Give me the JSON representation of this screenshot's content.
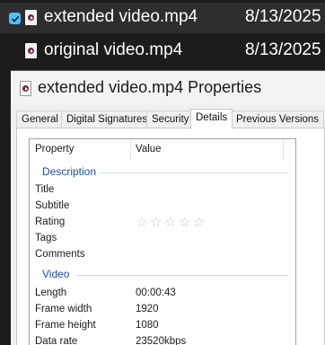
{
  "files": [
    {
      "name": "extended video.mp4",
      "date": "8/13/2025",
      "selected": true
    },
    {
      "name": "original video.mp4",
      "date": "8/13/2025",
      "selected": false
    }
  ],
  "dialog": {
    "title": "extended video.mp4 Properties",
    "tabs": [
      "General",
      "Digital Signatures",
      "Security",
      "Details",
      "Previous Versions"
    ],
    "active_tab": "Details",
    "columns": {
      "property": "Property",
      "value": "Value"
    },
    "sections": {
      "description": {
        "label": "Description",
        "rows": [
          {
            "property": "Title",
            "value": ""
          },
          {
            "property": "Subtitle",
            "value": ""
          },
          {
            "property": "Rating",
            "value": "",
            "stars": 0,
            "max_stars": 5
          },
          {
            "property": "Tags",
            "value": ""
          },
          {
            "property": "Comments",
            "value": ""
          }
        ]
      },
      "video": {
        "label": "Video",
        "rows": [
          {
            "property": "Length",
            "value": "00:00:43"
          },
          {
            "property": "Frame width",
            "value": "1920"
          },
          {
            "property": "Frame height",
            "value": "1080"
          },
          {
            "property": "Data rate",
            "value": "23520kbps"
          }
        ]
      }
    }
  },
  "colors": {
    "accent": "#4cc2ff",
    "section": "#1b4fa0"
  }
}
